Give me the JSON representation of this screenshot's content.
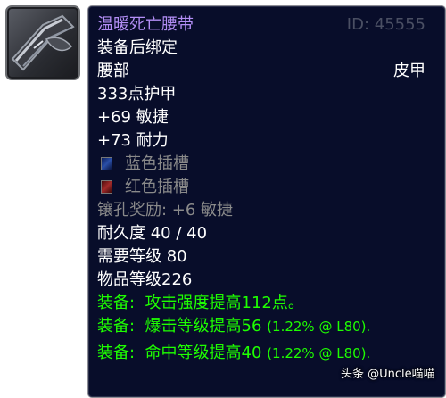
{
  "item": {
    "icon": "belt-icon",
    "name": "温暖死亡腰带",
    "id_label": "ID: 45555",
    "bind": "装备后绑定",
    "slot": "腰部",
    "armor_type": "皮甲",
    "armor": "333点护甲",
    "stats": [
      "+69 敏捷",
      "+73 耐力"
    ],
    "sockets": [
      {
        "color": "blue",
        "label": "蓝色插槽"
      },
      {
        "color": "red",
        "label": "红色插槽"
      }
    ],
    "socket_bonus": "镶孔奖励: +6 敏捷",
    "durability": "耐久度 40 / 40",
    "required_level": "需要等级 80",
    "item_level": "物品等级226",
    "equip_effects": [
      {
        "prefix": "装备:",
        "text": "攻击强度提高112点。",
        "note": ""
      },
      {
        "prefix": "装备:",
        "text": "爆击等级提高56",
        "note": "(1.22% @ L80)."
      },
      {
        "prefix": "装备:",
        "text": "命中等级提高40",
        "note": "(1.22% @ L80)."
      }
    ]
  },
  "colors": {
    "item_name": "#b38ef5",
    "equip": "#1eff00",
    "background": "#080d2a"
  },
  "watermark": "头条 @Uncle喵喵"
}
